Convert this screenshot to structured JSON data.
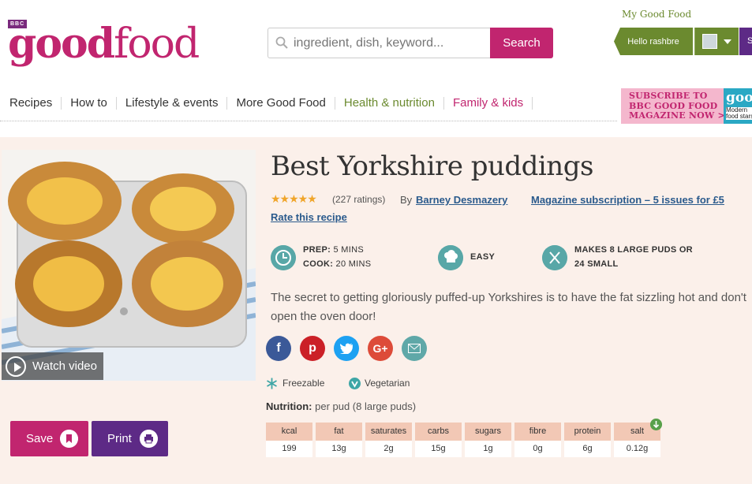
{
  "header": {
    "brand_tag": "BBC",
    "logo_bold": "good",
    "logo_light": "food",
    "search_placeholder": "ingredient, dish, keyword...",
    "search_label": "Search",
    "my_good_food": "My Good Food",
    "hello": "Hello rashbre",
    "side_button": "S"
  },
  "nav": {
    "items": [
      "Recipes",
      "How to",
      "Lifestyle & events",
      "More Good Food",
      "Health & nutrition",
      "Family & kids"
    ]
  },
  "promo": {
    "line1": "SUBSCRIBE TO",
    "line2": "BBC GOOD FOOD",
    "line3": "MAGAZINE NOW >>>",
    "mag_logo": "goo",
    "mag_sub": "Modern food stars"
  },
  "recipe": {
    "title": "Best Yorkshire puddings",
    "stars": "★★★★★",
    "ratings": "(227 ratings)",
    "by_label": "By",
    "author": "Barney Desmazery",
    "magazine_link": "Magazine subscription – 5 issues for £5",
    "rate_link": "Rate this recipe",
    "prep_label": "PREP:",
    "prep_value": "5 MINS",
    "cook_label": "COOK:",
    "cook_value": "20 MINS",
    "difficulty": "EASY",
    "serves_line1": "MAKES 8 LARGE PUDS OR",
    "serves_line2": "24 SMALL",
    "description_line1": "The secret to getting gloriously puffed-up Yorkshires is to have the fat sizzling hot and don't",
    "description_line2": "open the oven door!",
    "watch_video": "Watch video",
    "save_label": "Save",
    "print_label": "Print",
    "diet": [
      "Freezable",
      "Vegetarian"
    ],
    "nutrition_label": "Nutrition:",
    "nutrition_basis": "per pud (8 large puds)",
    "nutrition": [
      {
        "name": "kcal",
        "value": "199"
      },
      {
        "name": "fat",
        "value": "13g"
      },
      {
        "name": "saturates",
        "value": "2g"
      },
      {
        "name": "carbs",
        "value": "15g"
      },
      {
        "name": "sugars",
        "value": "1g"
      },
      {
        "name": "fibre",
        "value": "0g"
      },
      {
        "name": "protein",
        "value": "6g"
      },
      {
        "name": "salt",
        "value": "0.12g"
      }
    ]
  },
  "colors": {
    "brand_pink": "#c1256f",
    "brand_green": "#6b8a2f",
    "brand_purple": "#5d2a86",
    "teal": "#58a7a7",
    "background_tint": "#fbf0ea"
  },
  "icons": [
    "search-icon",
    "clock-icon",
    "chef-hat-icon",
    "cutlery-icon",
    "play-icon",
    "bookmark-icon",
    "printer-icon",
    "facebook-icon",
    "pinterest-icon",
    "twitter-icon",
    "google-plus-icon",
    "email-icon",
    "snowflake-icon",
    "vegetarian-icon",
    "chevron-down-icon"
  ]
}
